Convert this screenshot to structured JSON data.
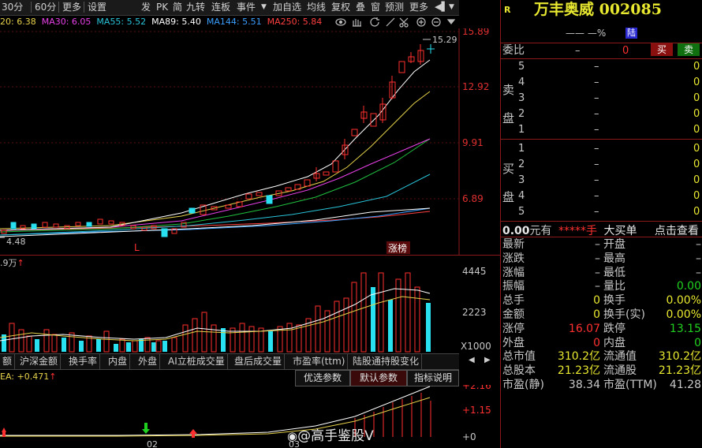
{
  "toolbar": {
    "left_items": [
      "30分",
      "60分",
      "更多",
      "设置"
    ],
    "right_items": [
      "发",
      "PK",
      "简",
      "九转",
      "连板",
      "事件",
      "加自选",
      "均线",
      "复权",
      "叠",
      "窗",
      "预测",
      "更多"
    ]
  },
  "ma_row": [
    {
      "text": "20: 6.38",
      "color": "#e6d24a"
    },
    {
      "text": "MA30: 6.05",
      "color": "#e840e8"
    },
    {
      "text": "MA55: 5.52",
      "color": "#28c4d8"
    },
    {
      "text": "MA89: 5.40",
      "color": "#ffffff"
    },
    {
      "text": "MA144: 5.51",
      "color": "#3aa0ff"
    },
    {
      "text": "MA250: 5.84",
      "color": "#ff4040"
    }
  ],
  "main_chart": {
    "price_labels": [
      "15.89",
      "12.92",
      "9.91",
      "6.89"
    ],
    "high_label": "15.29",
    "low_label": "4.48",
    "marker_L": "L",
    "zhangbang": "涨榜"
  },
  "volume": {
    "title": ".9万",
    "labels": [
      "4445",
      "2223",
      "X1000"
    ]
  },
  "tabs": [
    "额",
    "沪深金额",
    "换手率",
    "内盘",
    "外盘",
    "AI立桩成交量",
    "盘后成交量",
    "市盈率(ttm)",
    "陆股通持股变化"
  ],
  "indicator": {
    "title": "EA: +0.471",
    "buttons": [
      "优选参数",
      "默认参数",
      "指标说明"
    ],
    "labels": [
      "+2.16",
      "+1.15",
      "+0"
    ],
    "dates": [
      "02",
      "03"
    ]
  },
  "watermark": "@高手鉴股V",
  "stock": {
    "r_badge": "R",
    "name_code": "万丰奥威 002085",
    "price_line": "——  —%",
    "lu": "陆",
    "weibi_label": "委比",
    "weibi_value": "–",
    "weibi_diff": "0",
    "buy_btn": "买",
    "sell_btn": "卖",
    "sell_side": "卖盘",
    "buy_side": "买盘",
    "sell_levels": [
      {
        "n": "5",
        "p": "–",
        "v": "0"
      },
      {
        "n": "4",
        "p": "–",
        "v": "0"
      },
      {
        "n": "3",
        "p": "–",
        "v": "0"
      },
      {
        "n": "2",
        "p": "–",
        "v": "0"
      },
      {
        "n": "1",
        "p": "–",
        "v": "0"
      }
    ],
    "buy_levels": [
      {
        "n": "1",
        "p": "–",
        "v": "0"
      },
      {
        "n": "2",
        "p": "–",
        "v": "0"
      },
      {
        "n": "3",
        "p": "–",
        "v": "0"
      },
      {
        "n": "4",
        "p": "–",
        "v": "0"
      },
      {
        "n": "5",
        "p": "–",
        "v": "0"
      }
    ],
    "summary": {
      "a": "0.00",
      "b": "元有",
      "c": "*****",
      "d": "手",
      "e": "大买单",
      "f": "点击查看"
    },
    "stats": [
      {
        "l1": "最新",
        "v1": "–",
        "c1": "#c8c8c8",
        "l2": "开盘",
        "v2": "–",
        "c2": "#c8c8c8"
      },
      {
        "l1": "涨跌",
        "v1": "–",
        "c1": "#c8c8c8",
        "l2": "最高",
        "v2": "–",
        "c2": "#c8c8c8"
      },
      {
        "l1": "涨幅",
        "v1": "–",
        "c1": "#c8c8c8",
        "l2": "最低",
        "v2": "–",
        "c2": "#c8c8c8"
      },
      {
        "l1": "振幅",
        "v1": "–",
        "c1": "#c8c8c8",
        "l2": "量比",
        "v2": "0.00",
        "c2": "#20d020"
      },
      {
        "l1": "总手",
        "v1": "0",
        "c1": "#e8e830",
        "l2": "换手",
        "v2": "0.00%",
        "c2": "#e8e830"
      },
      {
        "l1": "金额",
        "v1": "0",
        "c1": "#e8e830",
        "l2": "换手(实)",
        "v2": "0.00%",
        "c2": "#e8e830"
      },
      {
        "l1": "涨停",
        "v1": "16.07",
        "c1": "#ff3030",
        "l2": "跌停",
        "v2": "13.15",
        "c2": "#20d020"
      },
      {
        "l1": "外盘",
        "v1": "0",
        "c1": "#ff3030",
        "l2": "内盘",
        "v2": "0",
        "c2": "#20d020"
      },
      {
        "l1": "总市值",
        "v1": "310.2亿",
        "c1": "#e8e830",
        "l2": "流通值",
        "v2": "310.2亿",
        "c2": "#e8e830"
      },
      {
        "l1": "总股本",
        "v1": "21.23亿",
        "c1": "#e8e830",
        "l2": "流通股",
        "v2": "21.23亿",
        "c2": "#e8e830"
      },
      {
        "l1": "市盈(静)",
        "v1": "38.34",
        "c1": "#c8c8c8",
        "l2": "市盈(TTM)",
        "v2": "41.28",
        "c2": "#c8c8c8"
      }
    ]
  }
}
